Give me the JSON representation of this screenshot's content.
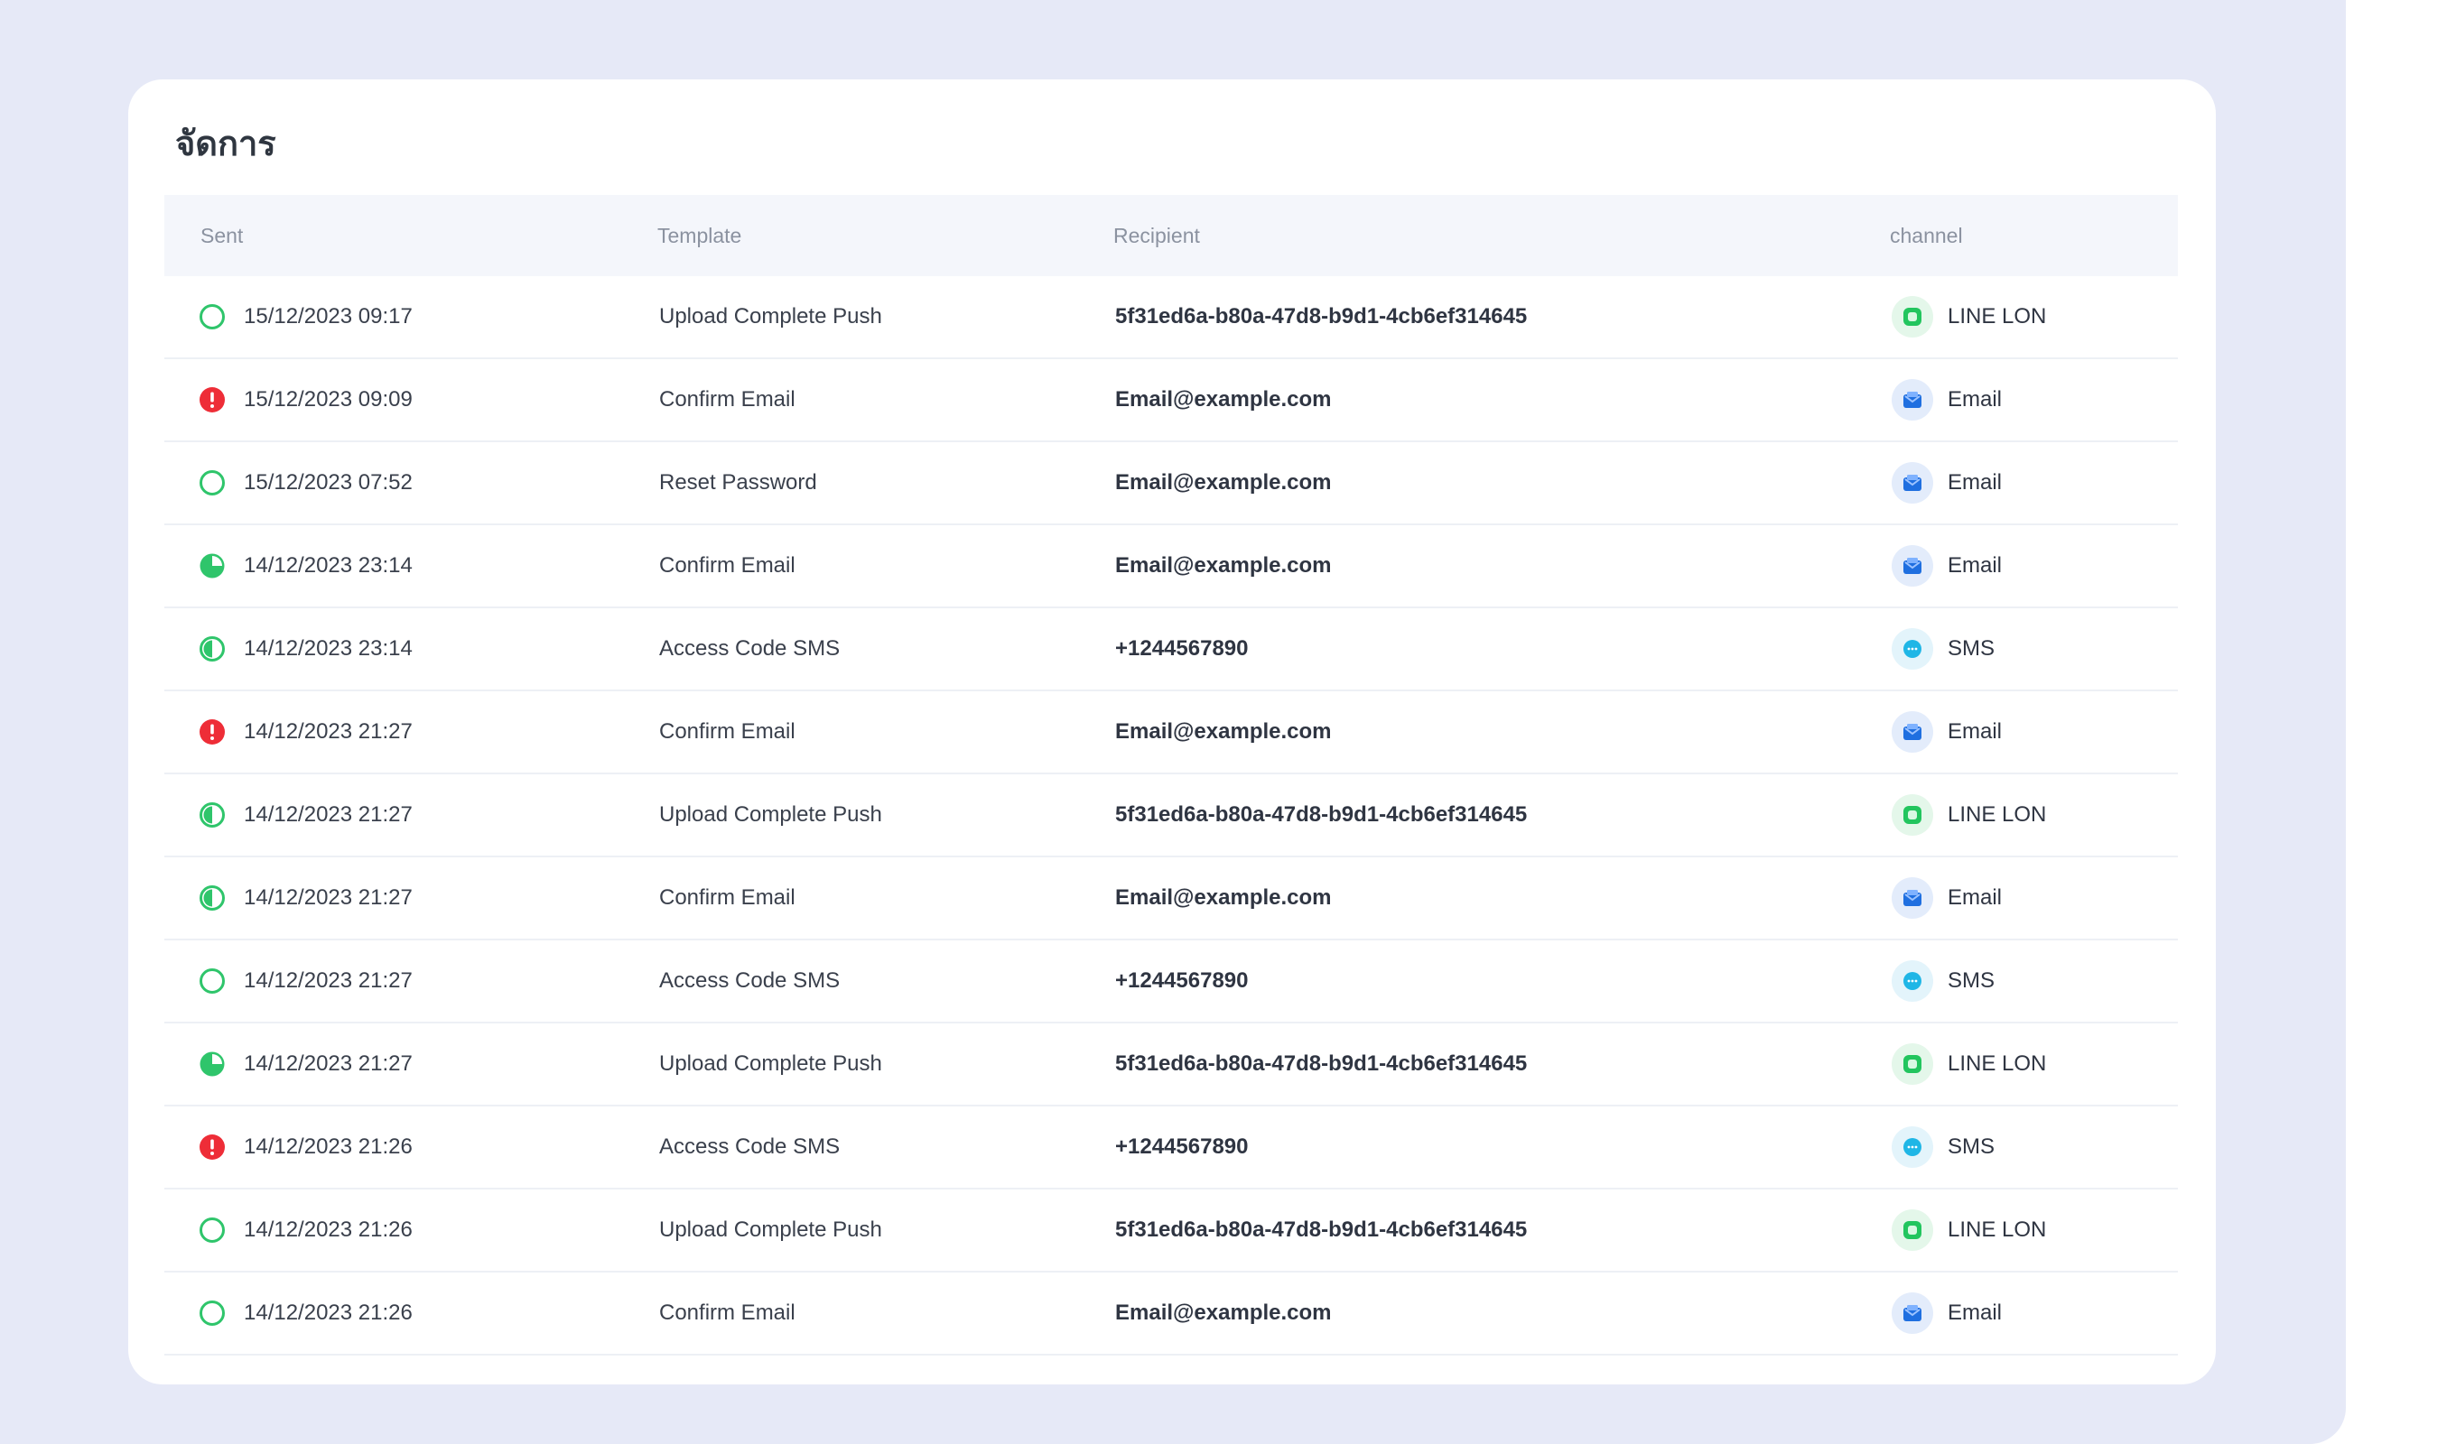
{
  "page": {
    "title": "จัดการ"
  },
  "table": {
    "columns": {
      "sent": "Sent",
      "template": "Template",
      "recipient": "Recipient",
      "channel": "channel"
    },
    "rows": [
      {
        "status": "complete-outline",
        "sent": "15/12/2023 09:17",
        "template": "Upload Complete Push",
        "recipient": "5f31ed6a-b80a-47d8-b9d1-4cb6ef314645",
        "channel": "LINE LON",
        "channel_icon": "line-icon"
      },
      {
        "status": "error",
        "sent": "15/12/2023 09:09",
        "template": "Confirm Email",
        "recipient": "Email@example.com",
        "channel": "Email",
        "channel_icon": "email-icon"
      },
      {
        "status": "complete-outline",
        "sent": "15/12/2023 07:52",
        "template": "Reset Password",
        "recipient": "Email@example.com",
        "channel": "Email",
        "channel_icon": "email-icon"
      },
      {
        "status": "three-quarter",
        "sent": "14/12/2023 23:14",
        "template": "Confirm Email",
        "recipient": "Email@example.com",
        "channel": "Email",
        "channel_icon": "email-icon"
      },
      {
        "status": "half",
        "sent": "14/12/2023 23:14",
        "template": "Access Code SMS",
        "recipient": "+1244567890",
        "channel": "SMS",
        "channel_icon": "sms-icon"
      },
      {
        "status": "error",
        "sent": "14/12/2023 21:27",
        "template": "Confirm Email",
        "recipient": "Email@example.com",
        "channel": "Email",
        "channel_icon": "email-icon"
      },
      {
        "status": "half",
        "sent": "14/12/2023 21:27",
        "template": "Upload Complete Push",
        "recipient": "5f31ed6a-b80a-47d8-b9d1-4cb6ef314645",
        "channel": "LINE LON",
        "channel_icon": "line-icon"
      },
      {
        "status": "half",
        "sent": "14/12/2023 21:27",
        "template": "Confirm Email",
        "recipient": "Email@example.com",
        "channel": "Email",
        "channel_icon": "email-icon"
      },
      {
        "status": "complete-outline",
        "sent": "14/12/2023 21:27",
        "template": "Access Code SMS",
        "recipient": "+1244567890",
        "channel": "SMS",
        "channel_icon": "sms-icon"
      },
      {
        "status": "three-quarter",
        "sent": "14/12/2023 21:27",
        "template": "Upload Complete Push",
        "recipient": "5f31ed6a-b80a-47d8-b9d1-4cb6ef314645",
        "channel": "LINE LON",
        "channel_icon": "line-icon"
      },
      {
        "status": "error",
        "sent": "14/12/2023 21:26",
        "template": "Access Code SMS",
        "recipient": "+1244567890",
        "channel": "SMS",
        "channel_icon": "sms-icon"
      },
      {
        "status": "complete-outline",
        "sent": "14/12/2023 21:26",
        "template": "Upload Complete Push",
        "recipient": "5f31ed6a-b80a-47d8-b9d1-4cb6ef314645",
        "channel": "LINE LON",
        "channel_icon": "line-icon"
      },
      {
        "status": "complete-outline",
        "sent": "14/12/2023 21:26",
        "template": "Confirm Email",
        "recipient": "Email@example.com",
        "channel": "Email",
        "channel_icon": "email-icon"
      }
    ]
  },
  "colors": {
    "backdrop": "#e6e9f7",
    "success": "#2fc56b",
    "error": "#ee2d37",
    "line": "#22c55e",
    "email": "#1f6fe0",
    "sms": "#1fb6e6"
  }
}
